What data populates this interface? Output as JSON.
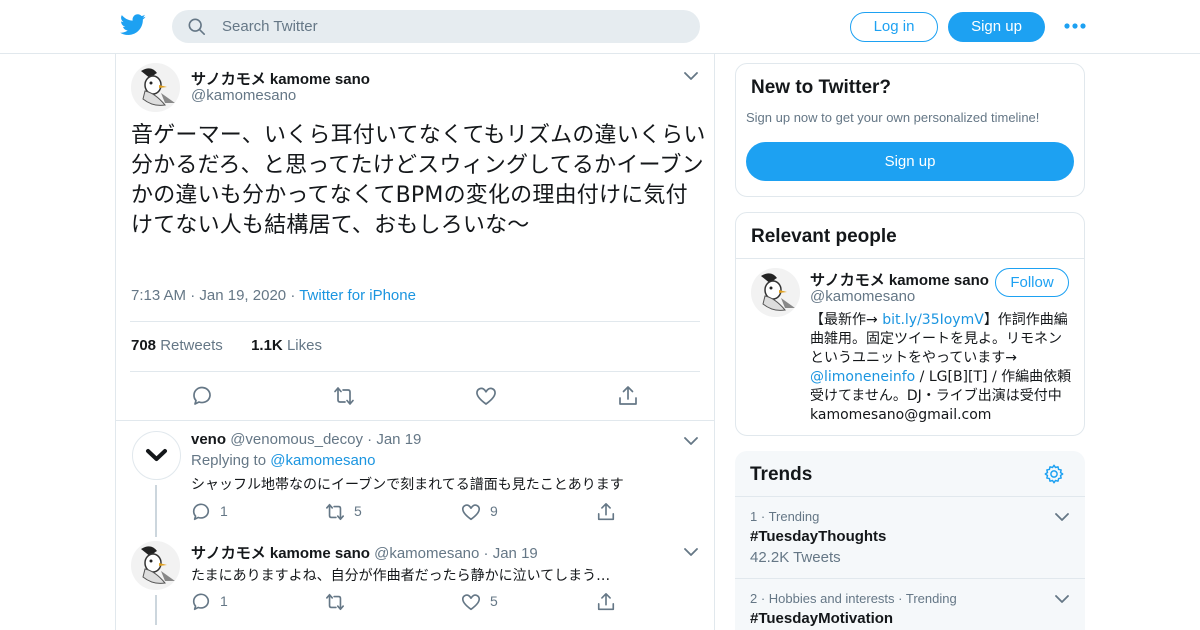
{
  "header": {
    "search_placeholder": "Search Twitter",
    "login_label": "Log in",
    "signup_label": "Sign up",
    "more_icon": "more-dots-icon",
    "logo_icon": "twitter-bird-icon"
  },
  "tweet": {
    "display_name": "サノカモメ kamome sano",
    "handle": "@kamomesano",
    "text": "音ゲーマー、いくら耳付いてなくてもリズムの違いくらい分かるだろ、と思ってたけどスウィングしてるかイーブンかの違いも分かってなくてBPMの変化の理由付けに気付けてない人も結構居て、おもしろいな〜",
    "time": "7:13 AM",
    "date": "Jan 19, 2020",
    "source": "Twitter for iPhone",
    "retweets_count": "708",
    "retweets_label": "Retweets",
    "likes_count": "1.1K",
    "likes_label": "Likes"
  },
  "replies": [
    {
      "display_name": "veno",
      "handle": "@venomous_decoy",
      "date": "Jan 19",
      "replying_label": "Replying to",
      "replying_to": "@kamomesano",
      "text": "シャッフル地帯なのにイーブンで刻まれてる譜面も見たことあります",
      "reply_count": "1",
      "retweet_count": "5",
      "like_count": "9"
    },
    {
      "display_name": "サノカモメ kamome sano",
      "handle": "@kamomesano",
      "date": "Jan 19",
      "text": "たまにありますよね、自分が作曲者だったら静かに泣いてしまう…",
      "reply_count": "1",
      "retweet_count": "",
      "like_count": "5"
    }
  ],
  "sidebar": {
    "new_to_twitter": {
      "title": "New to Twitter?",
      "subtitle": "Sign up now to get your own personalized timeline!",
      "signup_label": "Sign up"
    },
    "relevant_people": {
      "title": "Relevant people",
      "display_name": "サノカモメ kamome sano",
      "handle": "@kamomesano",
      "follow_label": "Follow",
      "bio_part1": "【最新作→ ",
      "bio_link1": "bit.ly/35IoymV",
      "bio_part2": "】作詞作曲編曲雑用。固定ツイートを見よ。リモネンというユニットをやっています→ ",
      "bio_link2": "@limoneneinfo",
      "bio_part3": " / LG[B][T] / 作編曲依頼受けてません。DJ・ライブ出演は受付中 kamomesano@gmail.com"
    },
    "trends": {
      "title": "Trends",
      "items": [
        {
          "rank": "1",
          "category": "Trending",
          "name": "#TuesdayThoughts",
          "count": "42.2K Tweets"
        },
        {
          "rank": "2",
          "category": "Hobbies and interests · Trending",
          "name": "#TuesdayMotivation",
          "count": ""
        }
      ]
    }
  },
  "colors": {
    "accent": "#1da1f2",
    "link": "#1b95e0",
    "muted": "#657786",
    "border": "#e1e8ed"
  }
}
